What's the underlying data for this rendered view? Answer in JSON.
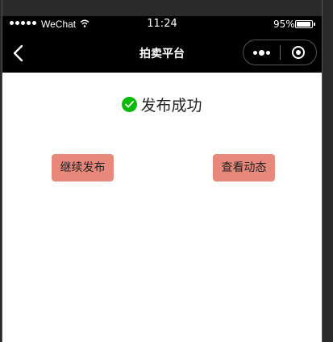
{
  "status_bar": {
    "carrier": "WeChat",
    "time": "11:24",
    "battery": "95%"
  },
  "navbar": {
    "title": "拍卖平台"
  },
  "main": {
    "message": "发布成功",
    "continue_button": "继续发布",
    "view_button": "查看动态"
  },
  "colors": {
    "button_bg": "#e8887a",
    "success_icon": "#09bb07",
    "navbar_bg": "#000000"
  }
}
